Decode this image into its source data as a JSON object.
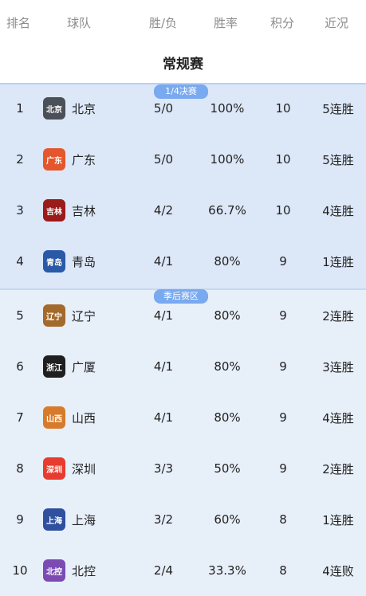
{
  "headers": {
    "rank": "排名",
    "team": "球队",
    "record": "胜/负",
    "win_rate": "胜率",
    "points": "积分",
    "recent": "近况"
  },
  "section_title": "常规赛",
  "zone_labels": {
    "quarterfinal": "1/4决赛",
    "playoff_zone": "季后赛区"
  },
  "rows": [
    {
      "rank": "1",
      "team": "北京",
      "record": "5/0",
      "win_rate": "100%",
      "points": "10",
      "recent": "5连胜",
      "logo": "北京"
    },
    {
      "rank": "2",
      "team": "广东",
      "record": "5/0",
      "win_rate": "100%",
      "points": "10",
      "recent": "5连胜",
      "logo": "广东"
    },
    {
      "rank": "3",
      "team": "吉林",
      "record": "4/2",
      "win_rate": "66.7%",
      "points": "10",
      "recent": "4连胜",
      "logo": "吉林"
    },
    {
      "rank": "4",
      "team": "青岛",
      "record": "4/1",
      "win_rate": "80%",
      "points": "9",
      "recent": "1连胜",
      "logo": "青岛"
    },
    {
      "rank": "5",
      "team": "辽宁",
      "record": "4/1",
      "win_rate": "80%",
      "points": "9",
      "recent": "2连胜",
      "logo": "辽宁"
    },
    {
      "rank": "6",
      "team": "广厦",
      "record": "4/1",
      "win_rate": "80%",
      "points": "9",
      "recent": "3连胜",
      "logo": "浙江"
    },
    {
      "rank": "7",
      "team": "山西",
      "record": "4/1",
      "win_rate": "80%",
      "points": "9",
      "recent": "4连胜",
      "logo": "山西"
    },
    {
      "rank": "8",
      "team": "深圳",
      "record": "3/3",
      "win_rate": "50%",
      "points": "9",
      "recent": "2连胜",
      "logo": "深圳"
    },
    {
      "rank": "9",
      "team": "上海",
      "record": "3/2",
      "win_rate": "60%",
      "points": "8",
      "recent": "1连胜",
      "logo": "上海"
    },
    {
      "rank": "10",
      "team": "北控",
      "record": "2/4",
      "win_rate": "33.3%",
      "points": "8",
      "recent": "4连败",
      "logo": "北控"
    }
  ]
}
